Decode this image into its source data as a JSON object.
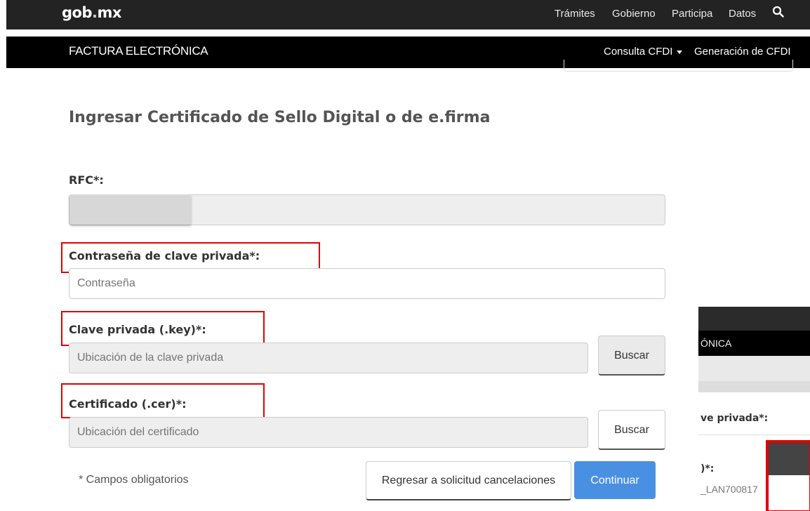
{
  "header": {
    "logo": "gob",
    "logo_dot": ".",
    "logo_suffix": "mx",
    "nav": [
      "Trámites",
      "Gobierno",
      "Participa",
      "Datos"
    ]
  },
  "subheader": {
    "title": "FACTURA ELECTRÓNICA",
    "menu_consulta": "Consulta CFDI",
    "menu_generacion": "Generación de CFDI"
  },
  "form": {
    "title": "Ingresar Certificado de Sello Digital o de e.firma",
    "rfc_label": "RFC*:",
    "password_label": "Contraseña de clave privada*:",
    "password_placeholder": "Contraseña",
    "key_label": "Clave privada (.key)*:",
    "key_placeholder": "Ubicación de la clave privada",
    "key_button": "Buscar",
    "cer_label": "Certificado (.cer)*:",
    "cer_placeholder": "Ubicación del certificado",
    "cer_button": "Buscar",
    "required_note": "* Campos obligatorios",
    "back_button": "Regresar a solicitud cancelaciones",
    "continue_button": "Continuar"
  },
  "preview": {
    "subtitle": "ÓNICA",
    "password_label": "ve privada*:",
    "key_label": ")*:",
    "key_value": "_LAN700817"
  },
  "colors": {
    "topbar": "#232323",
    "subbar": "#000000",
    "primary": "#4a90e2",
    "highlight": "#e00000"
  }
}
